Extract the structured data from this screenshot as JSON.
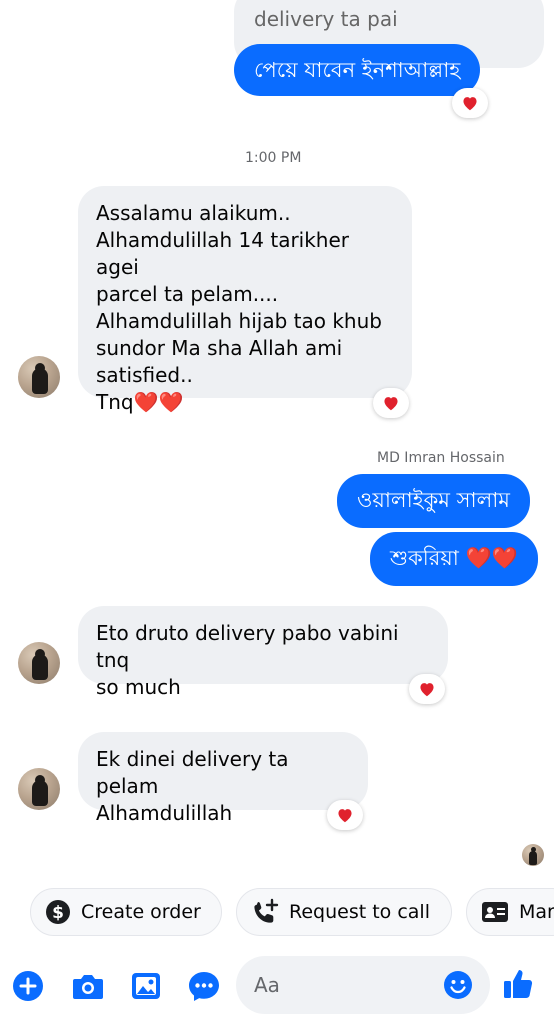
{
  "conversation": {
    "top_quoted": "delivery ta pai",
    "top_sent": "পেয়ে যাবেন ইনশাআল্লাহ",
    "timestamp": "1:00 PM",
    "msg1": {
      "lines": [
        "Assalamu alaikum..",
        "Alhamdulillah 14 tarikher agei",
        "parcel ta pelam....",
        "Alhamdulillah hijab tao khub",
        "sundor Ma sha Allah ami",
        "satisfied.."
      ],
      "last_line": "Tnq",
      "hearts": "❤️❤️"
    },
    "sender_name": "MD Imran Hossain",
    "reply1": "ওয়ালাইকুম সালাম",
    "reply2": "শুকরিয়া",
    "reply2_hearts": "❤️❤️",
    "msg2": {
      "line1": "Eto druto delivery pabo vabini tnq",
      "line2": "so much"
    },
    "msg3": {
      "line1": "Ek dinei delivery ta pelam",
      "line2": "Alhamdulillah"
    },
    "reaction": "heart"
  },
  "quick_actions": [
    {
      "label": "Create order",
      "icon": "dollar-icon"
    },
    {
      "label": "Request to call",
      "icon": "phone-plus-icon"
    },
    {
      "label": "Mar",
      "icon": "contact-card-icon"
    }
  ],
  "composer": {
    "placeholder": "Aa",
    "icons": [
      "plus-icon",
      "camera-icon",
      "image-icon",
      "more-chat-icon",
      "emoji-icon",
      "like-icon"
    ]
  },
  "colors": {
    "accent": "#0a6cff",
    "bubble_received": "#eef0f3",
    "heart": "#e0212d"
  }
}
